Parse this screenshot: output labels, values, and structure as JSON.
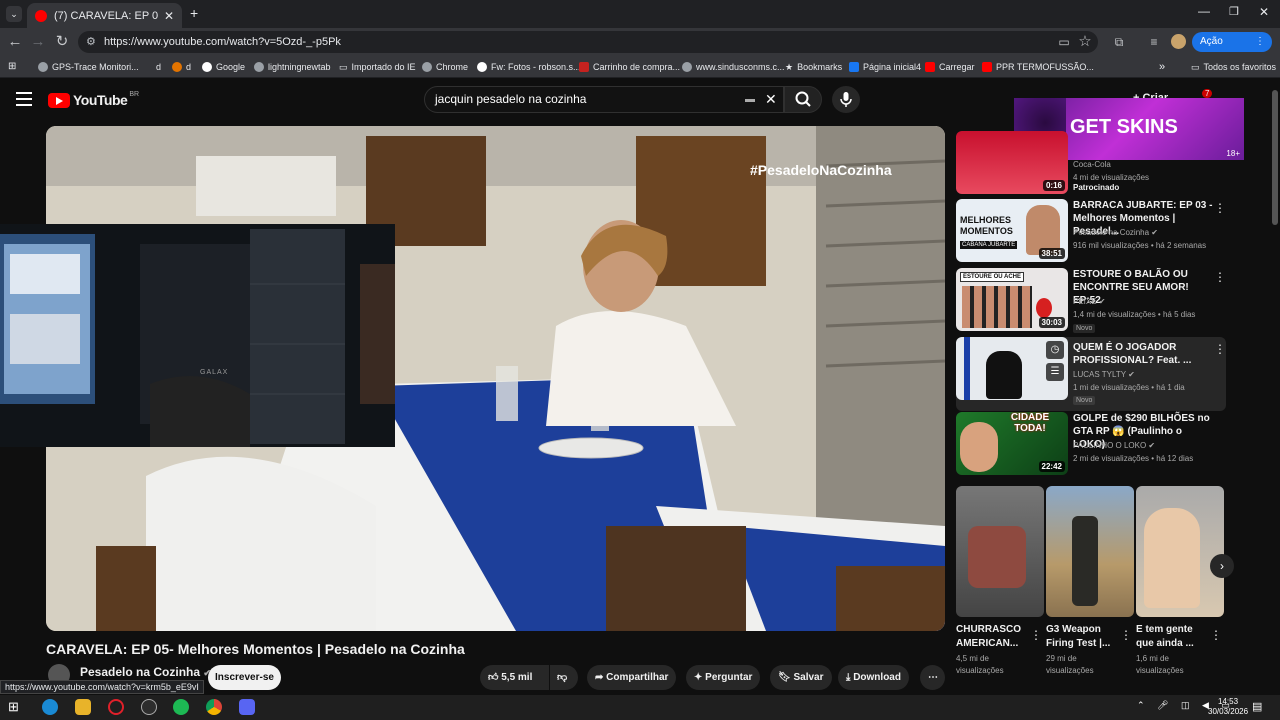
{
  "browser": {
    "tab_title": "(7) CARAVELA: EP 05- Melhores",
    "url": "https://www.youtube.com/watch?v=5Ozd-_-p5Pk",
    "action_button": "Ação necessária",
    "bookmarks": [
      "GPS-Trace Monitori...",
      "d",
      "d",
      "Google",
      "lightningnewtab",
      "Importado do IE",
      "Chrome",
      "Fw: Fotos - robson.s...",
      "Carrinho de compra...",
      "www.sindusconms.c...",
      "Bookmarks",
      "Página inicial4",
      "Carregar",
      "PPR TERMOFUSSÃO..."
    ],
    "all_favorites": "Todos os favoritos",
    "status_url": "https://www.youtube.com/watch?v=krm5b_eE9vI"
  },
  "youtube": {
    "logo_text": "YouTube",
    "logo_region": "BR",
    "search_query": "jacquin pesadelo na cozinha",
    "create_label": "Criar",
    "notifications_count": "7"
  },
  "ad": {
    "text": "GET SKINS",
    "age": "18+"
  },
  "video": {
    "hashtag": "#PesadeloNaCozinha",
    "overlay_label": "GALAX",
    "title": "CARAVELA: EP 05- Melhores Momentos | Pesadelo na Cozinha",
    "channel": "Pesadelo na Cozinha",
    "subscribe": "Inscrever-se",
    "likes": "5,5 mil",
    "share": "Compartilhar",
    "ask": "Perguntar",
    "save": "Salvar",
    "download": "Download"
  },
  "recommendations": [
    {
      "title": "",
      "channel": "Coca-Cola",
      "meta": "4 mi de visualizações",
      "badge": "Patrocinado",
      "duration": "0:16"
    },
    {
      "title": "BARRACA JUBARTE: EP 03 - Melhores Momentos | Pesadel...",
      "channel": "Pesadelo na Cozinha ✔",
      "meta": "916 mil visualizações • há 2 semanas",
      "badge": "",
      "duration": "38:51"
    },
    {
      "title": "ESTOURE O BALÃO OU ENCONTRE SEU AMOR! EP:52",
      "channel": "PEIXE ✔",
      "meta": "1,4 mi de visualizações • há 5 dias",
      "badge": "Novo",
      "duration": "30:03"
    },
    {
      "title": "QUEM É O JOGADOR PROFISSIONAL? Feat. ...",
      "channel": "LUCAS TYLTY ✔",
      "meta": "1 mi de visualizações • há 1 dia",
      "badge": "Novo",
      "duration": ""
    },
    {
      "title": "GOLPE de $290 BILHÕES no GTA RP 😱 (Paulinho o LOKO)",
      "channel": "PAULINHO O LOKO ✔",
      "meta": "2 mi de visualizações • há 12 dias",
      "badge": "",
      "duration": "22:42"
    }
  ],
  "thumb_texts": {
    "rec1_top": "MELHORES",
    "rec1_mid": "MOMENTOS",
    "rec1_bot": "CABANA JUBARTE",
    "rec2_banner": "ESTOURE OU ACHE",
    "rec4_banner": "CIDADE TODA!"
  },
  "shorts": [
    {
      "title": "CHURRASCO AMERICAN...",
      "views": "4,5 mi de visualizações"
    },
    {
      "title": "G3 Weapon Firing Test |...",
      "views": "29 mi de visualizações"
    },
    {
      "title": "E tem gente que ainda ...",
      "views": "1,6 mi de visualizações"
    }
  ],
  "taskbar": {
    "time": "14:53",
    "date": "30/03/2026"
  }
}
